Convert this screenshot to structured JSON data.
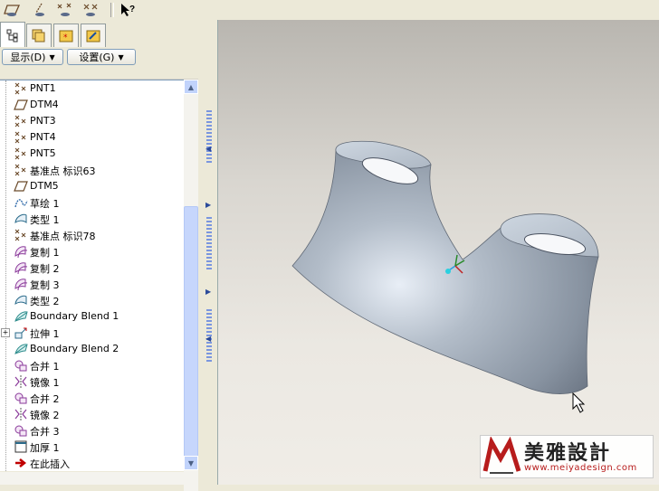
{
  "toolbar": {
    "icons": [
      "plane-datum-icon",
      "axis-datum-icon",
      "point-datum-icon",
      "csys-datum-icon",
      "context-help-icon"
    ]
  },
  "panel": {
    "tabs": [
      "model-tree-tab",
      "layers-tab",
      "favorites-tab",
      "connections-tab"
    ],
    "show_menu": "显示(D)",
    "settings_menu": "设置(G)"
  },
  "tree": {
    "items": [
      {
        "label": "PNT1",
        "icon": "datum-point-icon",
        "expand": false
      },
      {
        "label": "DTM4",
        "icon": "datum-plane-icon",
        "expand": false
      },
      {
        "label": "PNT3",
        "icon": "datum-point-icon",
        "expand": false
      },
      {
        "label": "PNT4",
        "icon": "datum-point-icon",
        "expand": false
      },
      {
        "label": "PNT5",
        "icon": "datum-point-icon",
        "expand": false
      },
      {
        "label": "基准点 标识63",
        "icon": "datum-point-icon",
        "expand": false
      },
      {
        "label": "DTM5",
        "icon": "datum-plane-icon",
        "expand": false
      },
      {
        "label": "草绘 1",
        "icon": "sketch-icon",
        "expand": false
      },
      {
        "label": "类型 1",
        "icon": "surface-icon",
        "expand": false
      },
      {
        "label": "基准点 标识78",
        "icon": "datum-point-icon",
        "expand": false
      },
      {
        "label": "复制 1",
        "icon": "copy-icon",
        "expand": false
      },
      {
        "label": "复制 2",
        "icon": "copy-icon",
        "expand": false
      },
      {
        "label": "复制 3",
        "icon": "copy-icon",
        "expand": false
      },
      {
        "label": "类型 2",
        "icon": "surface-icon",
        "expand": false
      },
      {
        "label": "Boundary Blend 1",
        "icon": "boundary-blend-icon",
        "expand": false
      },
      {
        "label": "拉伸 1",
        "icon": "extrude-icon",
        "expand": true
      },
      {
        "label": "Boundary Blend 2",
        "icon": "boundary-blend-icon",
        "expand": false
      },
      {
        "label": "合并 1",
        "icon": "merge-icon",
        "expand": false
      },
      {
        "label": "镜像 1",
        "icon": "mirror-icon",
        "expand": false
      },
      {
        "label": "合并 2",
        "icon": "merge-icon",
        "expand": false
      },
      {
        "label": "镜像 2",
        "icon": "mirror-icon",
        "expand": false
      },
      {
        "label": "合并 3",
        "icon": "merge-icon",
        "expand": false
      },
      {
        "label": "加厚 1",
        "icon": "thicken-icon",
        "expand": false
      },
      {
        "label": "在此插入",
        "icon": "insert-here-arrow-icon",
        "expand": false
      }
    ]
  },
  "watermark": {
    "title": "美雅設計",
    "url": "www.meiyadesign.com"
  },
  "colors": {
    "model_surface": "#9aa6b4",
    "insert_arrow": "#c00000",
    "watermark_red": "#b71c1c"
  }
}
